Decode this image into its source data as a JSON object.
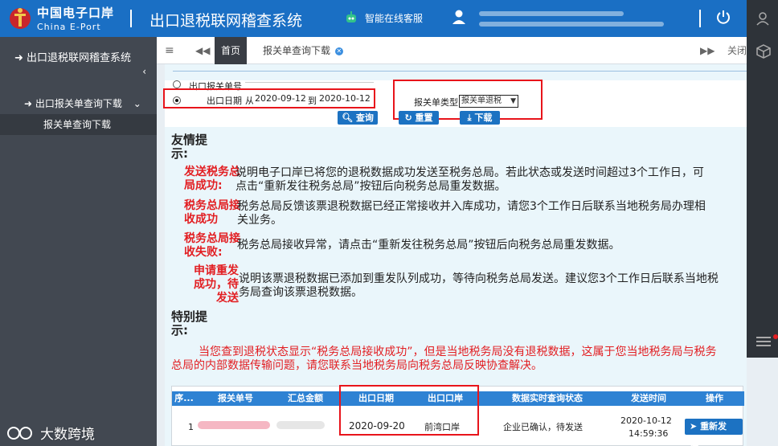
{
  "header": {
    "brand_cn": "中国电子口岸",
    "brand_en": "China E-Port",
    "app_title": "出口退税联网稽查系统",
    "service_label": "智能在线客服"
  },
  "sidebar": {
    "top_item": "出口退税联网稽查系统",
    "sub_item": "出口报关单查询下载",
    "leaf_item": "报关单查询下载"
  },
  "tabs": {
    "home": "首页",
    "active": "报关单查询下载",
    "close_others": "关闭"
  },
  "filter": {
    "option_decl_no": "出口报关单号",
    "option_date": "出口日期",
    "from_label": "从",
    "date_from": "2020-09-12",
    "to_label": "到",
    "date_to": "2020-10-12",
    "type_label": "报关单类型",
    "type_value": "报关单退税",
    "btn_query": "查询",
    "btn_reset": "重置",
    "btn_download": "下载"
  },
  "tips": {
    "title": "友情提示:",
    "items": [
      {
        "key": "发送税务总局成功:",
        "text": "说明电子口岸已将您的退税数据成功发送至税务总局。若此状态或发送时间超过3个工作日，可点击“重新发往税务总局”按钮后向税务总局重发数据。"
      },
      {
        "key": "税务总局接收成功",
        "text": "税务总局反馈该票退税数据已经正常接收并入库成功，请您3个工作日后联系当地税务局办理相关业务。"
      },
      {
        "key": "税务总局接收失败:",
        "text": "税务总局接收异常，请点击“重新发往税务总局”按钮后向税务总局重发数据。"
      },
      {
        "key": "申请重发成功，待发送",
        "text": "说明该票退税数据已添加到重发队列成功，等待向税务总局发送。建议您3个工作日后联系当地税务局查询该票退税数据。"
      }
    ]
  },
  "special": {
    "title": "特别提示:",
    "text": "当您查到退税状态显示“税务总局接收成功”，但是当地税务局没有退税数据，这属于您当地税务局与税务总局的内部数据传输问题，请您联系当地税务局向税务总局反映协查解决。"
  },
  "table": {
    "headers": [
      "序...",
      "报关单号",
      "汇总金额",
      "出口日期",
      "出口口岸",
      "数据实时查询状态",
      "发送时间",
      "操作"
    ],
    "row": {
      "index": "1",
      "export_date": "2020-09-20",
      "port": "前湾口岸",
      "status": "企业已确认，待发送",
      "send_date": "2020-10-12",
      "send_time": "14:59:36",
      "action": "重新发往..."
    }
  },
  "watermark": "大数跨境",
  "colors": {
    "header_bg": "#1a6fc4",
    "sidebar_bg": "#424851",
    "alert_red": "#e21e22",
    "table_head": "#2e82d3"
  }
}
